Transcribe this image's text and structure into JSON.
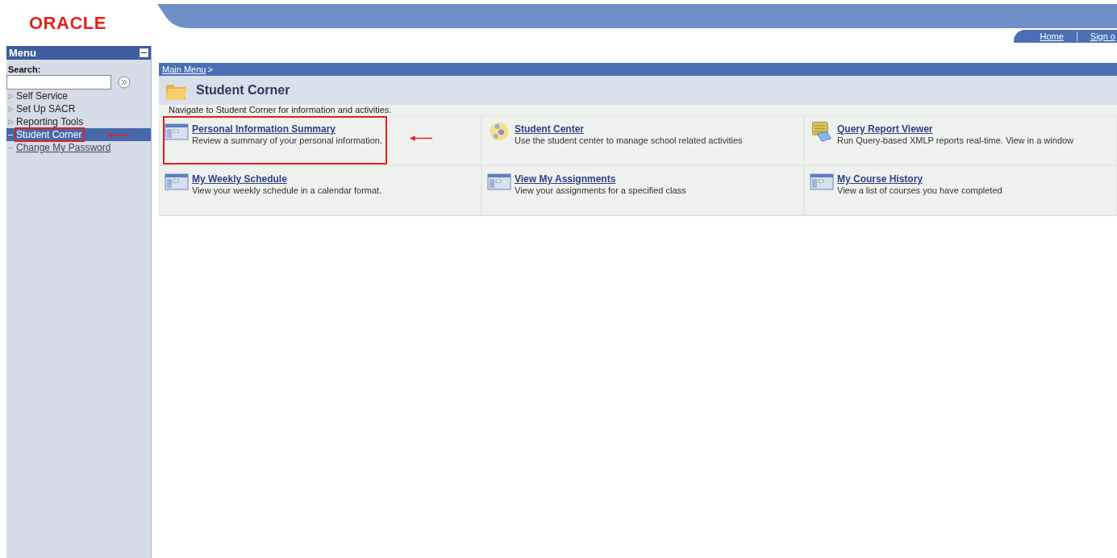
{
  "logo": "ORACLE",
  "header_links": [
    "Home",
    "Sign o"
  ],
  "menu": {
    "title": "Menu",
    "search_label": "Search:",
    "items": [
      {
        "label": "Self Service",
        "kind": "folder",
        "selected": false,
        "highlighted": false
      },
      {
        "label": "Set Up SACR",
        "kind": "folder",
        "selected": false,
        "highlighted": false
      },
      {
        "label": "Reporting Tools",
        "kind": "folder",
        "selected": false,
        "highlighted": false
      },
      {
        "label": "Student Corner",
        "kind": "open",
        "selected": true,
        "highlighted": true
      },
      {
        "label": "Change My Password",
        "kind": "link",
        "selected": false,
        "highlighted": false
      }
    ]
  },
  "breadcrumb": {
    "link": "Main Menu",
    "separator": ">"
  },
  "page": {
    "title": "Student Corner",
    "description": "Navigate to Student Corner for information and activities.",
    "tiles": [
      {
        "title": "Personal Information Summary",
        "text": "Review a summary of your personal information.",
        "kind": "page",
        "highlighted": true
      },
      {
        "title": "Student Center",
        "text": "Use the student center to manage school related activities",
        "kind": "people",
        "highlighted": false
      },
      {
        "title": "Query Report Viewer",
        "text": "Run Query-based XMLP reports real-time. View in a window",
        "kind": "query",
        "highlighted": false
      },
      {
        "title": "My Weekly Schedule",
        "text": "View your weekly schedule in a calendar format.",
        "kind": "page",
        "highlighted": false
      },
      {
        "title": "View My Assignments",
        "text": "View your assignments for a specified class",
        "kind": "page",
        "highlighted": false
      },
      {
        "title": "My Course History",
        "text": "View a list of courses you have completed",
        "kind": "page",
        "highlighted": false
      }
    ]
  }
}
